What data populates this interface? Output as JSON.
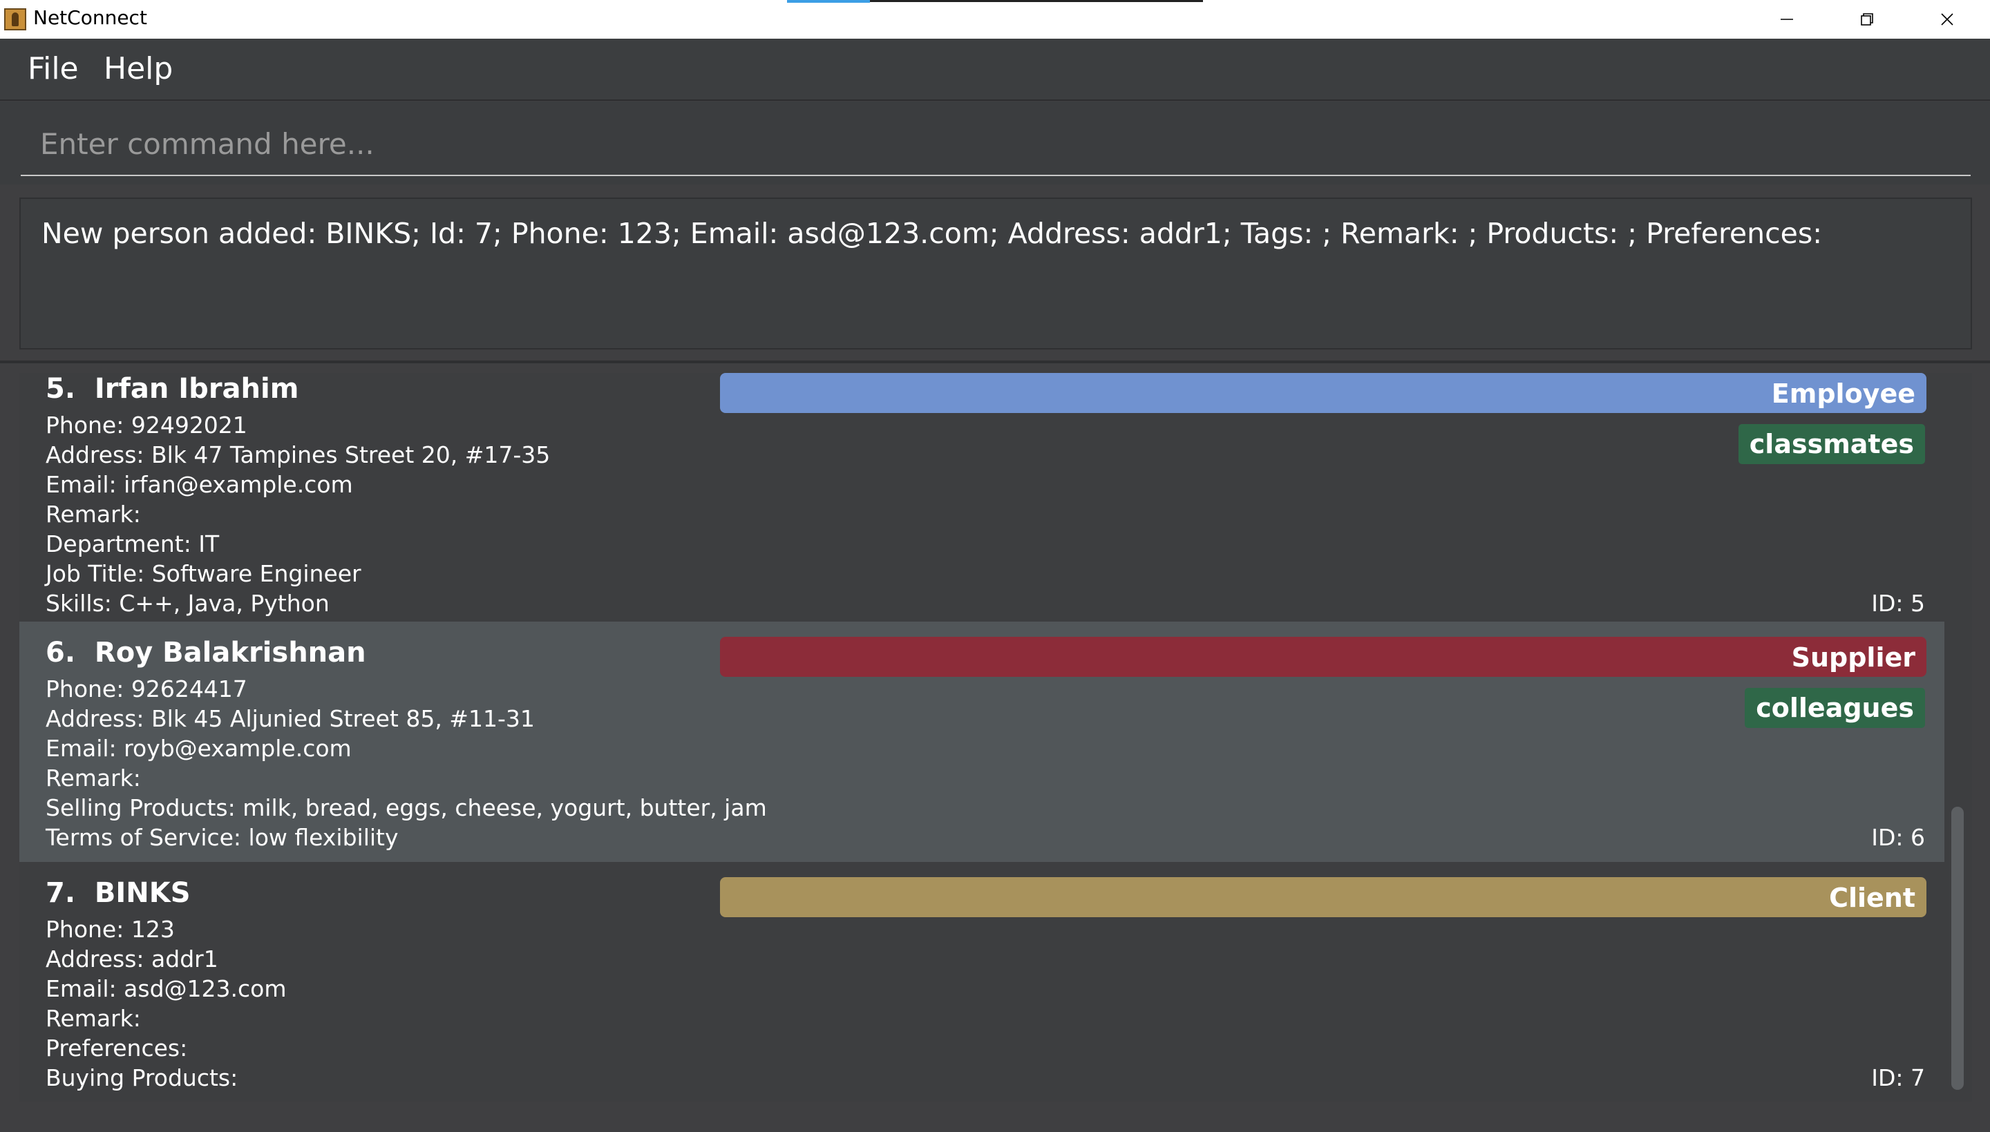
{
  "window": {
    "title": "NetConnect",
    "controls": {
      "minimize": "minimize-icon",
      "maximize": "restore-icon",
      "close": "close-icon"
    }
  },
  "menu": {
    "file": "File",
    "help": "Help"
  },
  "command": {
    "placeholder": "Enter command here...",
    "value": ""
  },
  "result": {
    "text": "New person added: BINKS; Id: 7; Phone: 123; Email: asd@123.com; Address: addr1; Tags: ; Remark: ; Products: ; Preferences:"
  },
  "persons": [
    {
      "index": "5.",
      "name": "Irfan Ibrahim",
      "role": "Employee",
      "role_color": "#7092d0",
      "tags": [
        "classmates"
      ],
      "lines": [
        "Phone: 92492021",
        "Address: Blk 47 Tampines Street 20, #17-35",
        "Email: irfan@example.com",
        "Remark:",
        "Department: IT",
        "Job Title: Software Engineer",
        "Skills: C++, Java, Python"
      ],
      "id": "ID: 5"
    },
    {
      "index": "6.",
      "name": "Roy Balakrishnan",
      "role": "Supplier",
      "role_color": "#8c2c39",
      "tags": [
        "colleagues"
      ],
      "lines": [
        "Phone: 92624417",
        "Address: Blk 45 Aljunied Street 85, #11-31",
        "Email: royb@example.com",
        "Remark:",
        "Selling Products: milk, bread, eggs, cheese, yogurt, butter, jam",
        "Terms of Service: low flexibility"
      ],
      "id": "ID: 6"
    },
    {
      "index": "7.",
      "name": "BINKS",
      "role": "Client",
      "role_color": "#a8925c",
      "tags": [],
      "lines": [
        "Phone: 123",
        "Address: addr1",
        "Email: asd@123.com",
        "Remark:",
        "Preferences:",
        "Buying Products:"
      ],
      "id": "ID: 7"
    }
  ]
}
